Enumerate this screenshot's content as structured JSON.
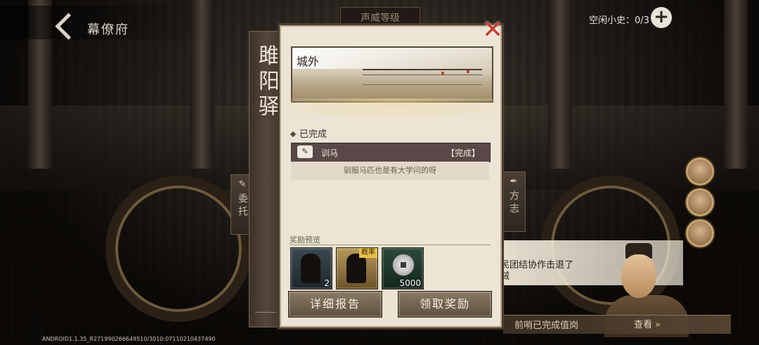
{
  "header": {
    "back_title": "幕僚府",
    "prestige_label": "声威等级",
    "idle_label": "空闲小史：0/3",
    "add_icon": "plus-icon"
  },
  "side_tabs": {
    "left": "委托",
    "right": "方志"
  },
  "panel": {
    "banner_title": "雎阳驿",
    "scene_title": "城外",
    "section_completed": "已完成",
    "task": {
      "name": "训马",
      "status": "【完成】",
      "description": "驯服马匹也是有大学问的呀"
    },
    "reward_label": "奖励预览",
    "rewards": [
      {
        "kind": "card",
        "quantity": "2",
        "tag": ""
      },
      {
        "kind": "card",
        "quantity": "",
        "tag": "概率"
      },
      {
        "kind": "coin",
        "quantity": "5000",
        "tag": ""
      }
    ],
    "buttons": {
      "report": "详细报告",
      "claim": "领取奖励"
    }
  },
  "message": {
    "line1": "民团结协作击退了",
    "line2": "贼"
  },
  "progress": {
    "text": "前哨已完成值岗",
    "view_label": "查看"
  },
  "footer": {
    "build_id": "ANDROID1.1.35_R271990266649510/3010:07110210437490"
  },
  "colors": {
    "panel_bg": "#ece4d4",
    "task_row": "#5a4848",
    "close_x": "#c83c30",
    "tag_gold": "#e8c048"
  }
}
